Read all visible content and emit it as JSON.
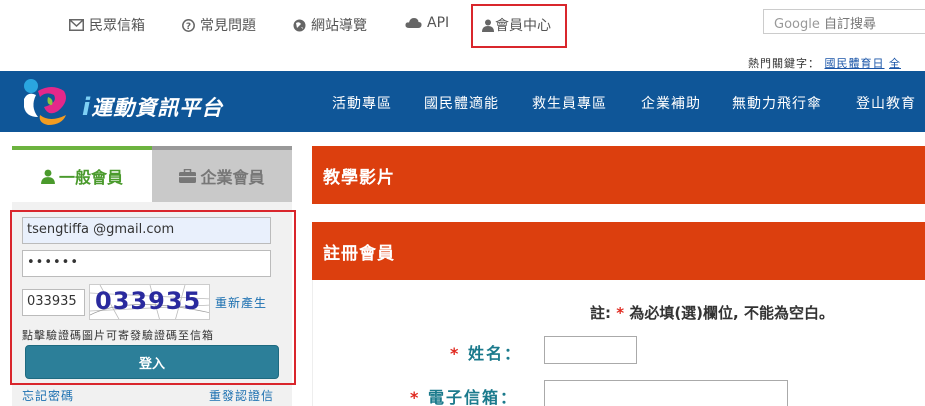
{
  "top_links": {
    "mail": "民眾信箱",
    "faq": "常見問題",
    "sitemap": "網站導覽",
    "api": "API",
    "member": "會員中心"
  },
  "search": {
    "brand": "Google",
    "label": "自訂搜尋"
  },
  "hot_keywords": {
    "label": "熱門關鍵字：",
    "item1": "國民體育日",
    "item2": "全"
  },
  "logo": {
    "title": "運動資訊平台"
  },
  "nav": [
    "活動專區",
    "國民體適能",
    "救生員專區",
    "企業補助",
    "無動力飛行傘",
    "登山教育"
  ],
  "tabs": {
    "general": "一般會員",
    "business": "企業會員"
  },
  "login": {
    "email_value": "tsengtiffa       @gmail.com",
    "password_value": "••••••",
    "captcha_value": "033935",
    "captcha_image_text": "033935",
    "regenerate": "重新產生",
    "hint": "點擊驗證碼圖片可寄發驗證碼至信箱",
    "submit": "登入",
    "forgot": "忘記密碼",
    "resend": "重發認證信"
  },
  "sections": {
    "video": "教學影片",
    "register": "註冊會員"
  },
  "register": {
    "note_prefix": "註:",
    "note_star": "*",
    "note_text": "為必填(選)欄位, 不能為空白。",
    "name_label": "姓名：",
    "email_label": "電子信箱："
  },
  "colors": {
    "nav_blue": "#0f5698",
    "accent_orange": "#dc3f0e",
    "highlight_red": "#d9262c",
    "login_teal": "#2c7f99"
  }
}
